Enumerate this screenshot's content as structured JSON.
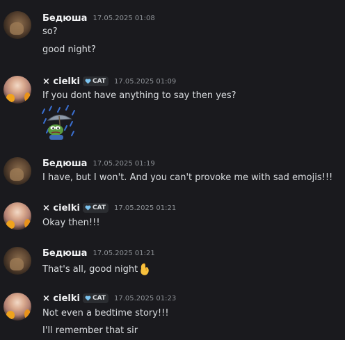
{
  "messages": [
    {
      "author": "Бедюша",
      "timestamp": "17.05.2025 01:08",
      "lines": [
        "so?",
        "good night?"
      ]
    },
    {
      "author": "× cielki",
      "badge": "CAT",
      "timestamp": "17.05.2025 01:09",
      "lines": [
        "If you dont have anything to say then yes?"
      ],
      "attachment": "sad-pepe-rain-emoji"
    },
    {
      "author": "Бедюша",
      "timestamp": "17.05.2025 01:19",
      "lines": [
        "I have, but I won't. And you can't provoke me with sad emojis!!!"
      ]
    },
    {
      "author": "× cielki",
      "badge": "CAT",
      "timestamp": "17.05.2025 01:21",
      "lines": [
        "Okay then!!!"
      ]
    },
    {
      "author": "Бедюша",
      "timestamp": "17.05.2025 01:21",
      "lines": [
        "That's all, good night"
      ],
      "inline_emoji": "pinched-fingers-emoji"
    },
    {
      "author": "× cielki",
      "badge": "CAT",
      "timestamp": "17.05.2025 01:23",
      "lines": [
        "Not even a bedtime story!!!",
        "I'll remember that sir"
      ]
    }
  ],
  "colors": {
    "background": "#1a1a1e",
    "author": "#f2f3f5",
    "text": "#dbdee1",
    "timestamp": "#8e9297",
    "badge_heart": "#7cc4f0"
  }
}
